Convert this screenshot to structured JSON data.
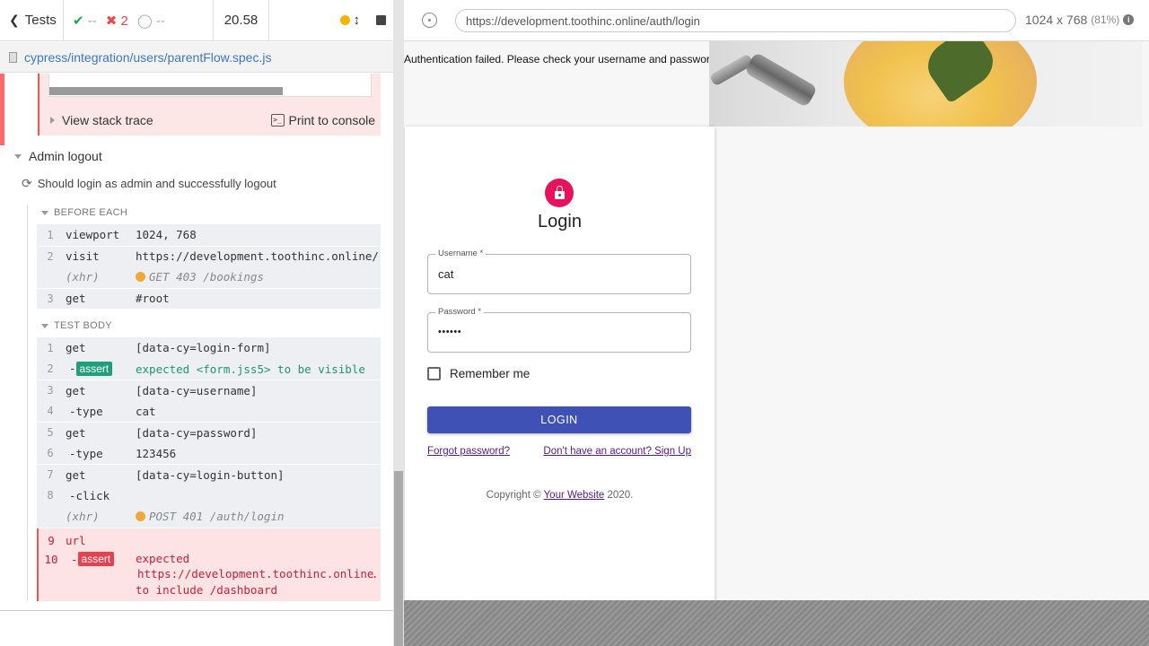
{
  "reporter": {
    "back_label": "Tests",
    "passed": "--",
    "failed": "2",
    "pending": "--",
    "duration": "20.58",
    "spec_path": "cypress/integration/users/parentFlow.spec.js",
    "view_stack_trace": "View stack trace",
    "print_to_console": "Print to console",
    "suite_title": "Admin logout",
    "test_title": "Should login as admin and successfully logout",
    "before_each_label": "BEFORE EACH",
    "test_body_label": "TEST BODY",
    "before_each": [
      {
        "num": "1",
        "name": "viewport",
        "msg": "1024, 768"
      },
      {
        "num": "2",
        "name": "visit",
        "msg": "https://development.toothinc.online/"
      },
      {
        "num": "",
        "name": "(xhr)",
        "msg": "GET 403 /bookings",
        "xhr": true
      },
      {
        "num": "3",
        "name": "get",
        "msg": "#root"
      }
    ],
    "test_body": [
      {
        "num": "1",
        "name": "get",
        "msg": "[data-cy=login-form]"
      },
      {
        "num": "2",
        "name": "-",
        "badge": "assert",
        "msg": "expected <form.jss5> to be visible"
      },
      {
        "num": "3",
        "name": "get",
        "msg": "[data-cy=username]"
      },
      {
        "num": "4",
        "name": "-type",
        "msg": "cat"
      },
      {
        "num": "5",
        "name": "get",
        "msg": "[data-cy=password]"
      },
      {
        "num": "6",
        "name": "-type",
        "msg": "123456"
      },
      {
        "num": "7",
        "name": "get",
        "msg": "[data-cy=login-button]"
      },
      {
        "num": "8",
        "name": "-click",
        "msg": ""
      },
      {
        "num": "",
        "name": "(xhr)",
        "msg": "POST 401 /auth/login",
        "xhr": true
      }
    ],
    "failed_cmd": {
      "num9": "9",
      "name9": "url",
      "num10": "10",
      "name10": "-",
      "badge": "assert",
      "line1": "expected",
      "line2": "https://development.toothinc.online…",
      "line3": "to include /dashboard"
    }
  },
  "aut_header": {
    "url": "https://development.toothinc.online/auth/login",
    "viewport": "1024 x 768",
    "scale": "(81%)"
  },
  "aut": {
    "auth_error": "Authentication failed. Please check your username and password.",
    "login_title": "Login",
    "username_label": "Username *",
    "username_value": "cat",
    "password_label": "Password *",
    "password_value": "••••••",
    "remember_label": "Remember me",
    "login_button": "LOGIN",
    "forgot_link": "Forgot password?",
    "signup_link": "Don't have an account? Sign Up",
    "copyright_prefix": "Copyright ©",
    "copyright_link": "Your Website",
    "copyright_suffix": "2020."
  },
  "colors": {
    "pass": "#1fa84f",
    "fail": "#e84a4a",
    "accent": "#3f51b5",
    "lock": "#e8125c"
  }
}
